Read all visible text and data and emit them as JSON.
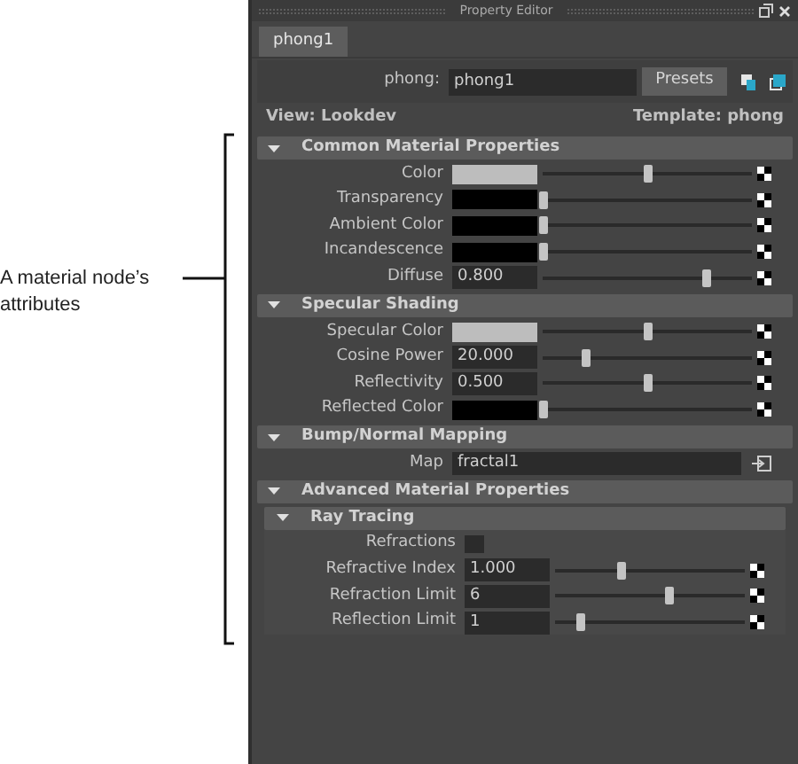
{
  "annotation": {
    "text": "A material node’s attributes"
  },
  "window": {
    "title": "Property Editor"
  },
  "tabs": [
    {
      "label": "phong1",
      "selected": true
    }
  ],
  "node": {
    "label": "phong:",
    "value": "phong1",
    "presets_button": "Presets"
  },
  "view": {
    "label": "View: Lookdev",
    "template": "Template: phong"
  },
  "sections": [
    {
      "title": "Common Material Properties",
      "expanded": true,
      "rows": [
        {
          "kind": "color",
          "label": "Color",
          "color": "#bdbdbd",
          "level": 0.5
        },
        {
          "kind": "color",
          "label": "Transparency",
          "color": "#000000",
          "level": 0
        },
        {
          "kind": "color",
          "label": "Ambient Color",
          "color": "#000000",
          "level": 0
        },
        {
          "kind": "color",
          "label": "Incandescence",
          "color": "#000000",
          "level": 0
        },
        {
          "kind": "number",
          "label": "Diffuse",
          "value": "0.800",
          "level": 0.78
        }
      ]
    },
    {
      "title": "Specular Shading",
      "expanded": true,
      "rows": [
        {
          "kind": "color",
          "label": "Specular Color",
          "color": "#bdbdbd",
          "level": 0.5
        },
        {
          "kind": "number",
          "label": "Cosine Power",
          "value": "20.000",
          "level": 0.2
        },
        {
          "kind": "number",
          "label": "Reflectivity",
          "value": "0.500",
          "level": 0.5
        },
        {
          "kind": "color",
          "label": "Reflected Color",
          "color": "#000000",
          "level": 0
        }
      ]
    },
    {
      "title": "Bump/Normal Mapping",
      "expanded": true,
      "rows": [
        {
          "kind": "map",
          "label": "Map",
          "value": "fractal1"
        }
      ]
    },
    {
      "title": "Advanced Material Properties",
      "expanded": true,
      "children": [
        {
          "title": "Ray Tracing",
          "expanded": true,
          "rows": [
            {
              "kind": "checkbox",
              "label": "Refractions",
              "checked": false
            },
            {
              "kind": "number",
              "label": "Refractive Index",
              "value": "1.000",
              "level": 0.35
            },
            {
              "kind": "number",
              "label": "Refraction Limit",
              "value": "6",
              "level": 0.6
            },
            {
              "kind": "number",
              "label": "Reflection Limit",
              "value": "1",
              "level": 0.13
            }
          ]
        }
      ]
    }
  ]
}
